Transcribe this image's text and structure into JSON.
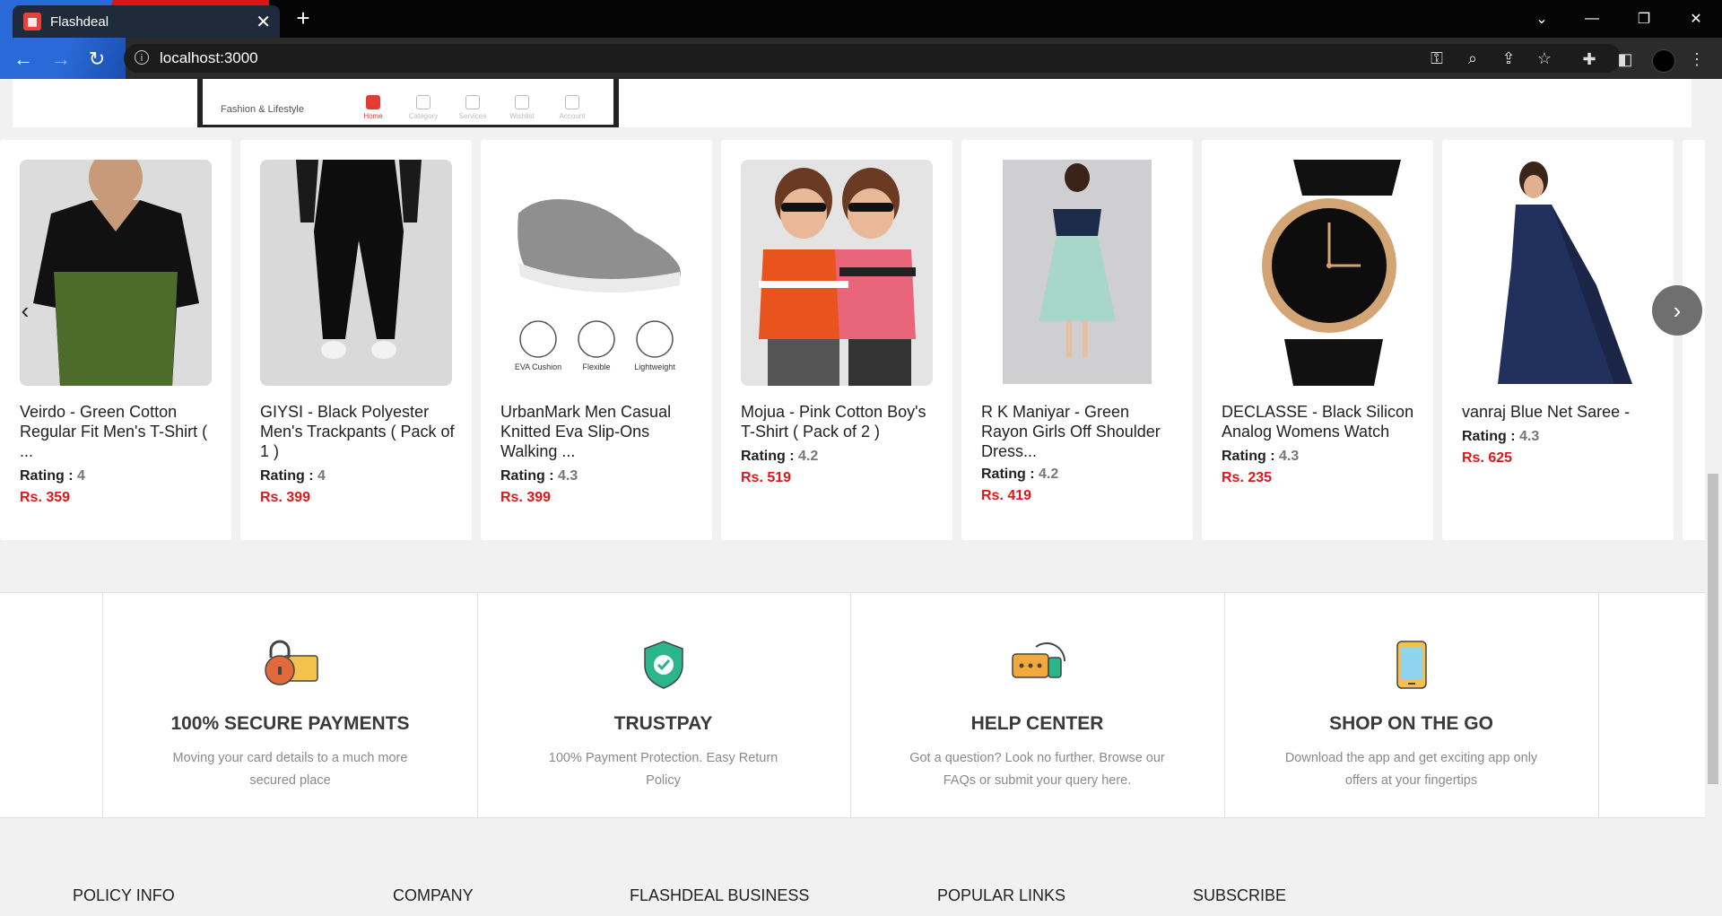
{
  "browser": {
    "tab_title": "Flashdeal",
    "url": "localhost:3000"
  },
  "phone_preview": {
    "store_label": "Fashion & Lifestyle",
    "nav": [
      "Home",
      "Category",
      "Services",
      "Wishlist",
      "Account"
    ]
  },
  "products": [
    {
      "name": "Veirdo - Green Cotton Regular Fit Men's T-Shirt ( ...",
      "rating_label": "Rating :",
      "rating": "4",
      "price": "Rs. 359"
    },
    {
      "name": "GIYSI - Black Polyester Men's Trackpants ( Pack of 1 )",
      "rating_label": "Rating :",
      "rating": "4",
      "price": "Rs. 399"
    },
    {
      "name": "UrbanMark Men Casual Knitted Eva Slip-Ons Walking ...",
      "rating_label": "Rating :",
      "rating": "4.3",
      "price": "Rs. 399"
    },
    {
      "name": "Mojua - Pink Cotton Boy's T-Shirt ( Pack of 2 )",
      "rating_label": "Rating :",
      "rating": "4.2",
      "price": "Rs. 519"
    },
    {
      "name": "R K Maniyar - Green Rayon Girls Off Shoulder Dress...",
      "rating_label": "Rating :",
      "rating": "4.2",
      "price": "Rs. 419"
    },
    {
      "name": "DECLASSE - Black Silicon Analog Womens Watch",
      "rating_label": "Rating :",
      "rating": "4.3",
      "price": "Rs. 235"
    },
    {
      "name": "vanraj Blue Net Saree -",
      "rating_label": "Rating :",
      "rating": "4.3",
      "price": "Rs. 625"
    }
  ],
  "shoe_features": [
    "EVA Cushion",
    "Flexible",
    "Lightweight"
  ],
  "features": [
    {
      "title": "100% SECURE PAYMENTS",
      "desc": "Moving your card details to a much more secured place",
      "icon": "padlock-card-icon"
    },
    {
      "title": "TRUSTPAY",
      "desc": "100% Payment Protection. Easy Return Policy",
      "icon": "shield-check-icon"
    },
    {
      "title": "HELP CENTER",
      "desc": "Got a question? Look no further. Browse our FAQs or submit your query here.",
      "icon": "chat-headset-icon"
    },
    {
      "title": "SHOP ON THE GO",
      "desc": "Download the app and get exciting app only offers at your fingertips",
      "icon": "mobile-phone-icon"
    }
  ],
  "footer_headings": [
    "POLICY INFO",
    "COMPANY",
    "FLASHDEAL BUSINESS",
    "POPULAR LINKS",
    "SUBSCRIBE"
  ],
  "colors": {
    "price": "#e0161a",
    "accent_red": "#e53935"
  }
}
